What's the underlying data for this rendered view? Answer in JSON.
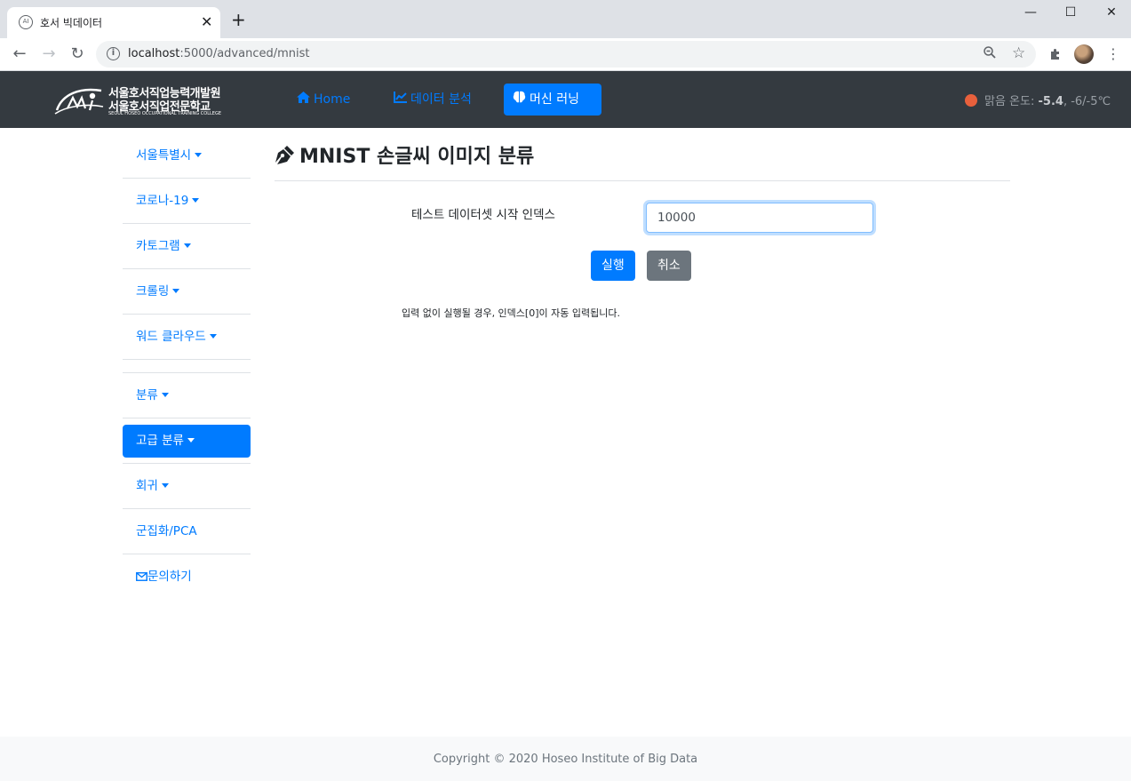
{
  "browser": {
    "tab_title": "호서 빅데이터",
    "tab_favicon": "AI",
    "url_host": "localhost",
    "url_path": ":5000/advanced/mnist"
  },
  "navbar": {
    "logo_line1": "서울호서직업능력개발원",
    "logo_line2": "서울호서직업전문학교",
    "logo_line3": "SEOUL HOSEO OCCUPATIONAL TRAINING COLLEGE",
    "links": [
      {
        "label": "Home",
        "icon": "home-icon"
      },
      {
        "label": "데이터 분석",
        "icon": "chart-line-icon"
      },
      {
        "label": "머신 러닝",
        "icon": "brain-icon",
        "active": true
      }
    ],
    "weather_label": "맑음 온도: ",
    "weather_temp": "-5.4",
    "weather_range": ", -6/-5℃",
    "weather_color": "#e8603c"
  },
  "sidebar": {
    "items": [
      {
        "label": "서울특별시",
        "dropdown": true
      },
      {
        "label": "코로나-19",
        "dropdown": true
      },
      {
        "label": "카토그램",
        "dropdown": true
      },
      {
        "label": "크롤링",
        "dropdown": true
      },
      {
        "label": "워드 클라우드",
        "dropdown": true
      },
      {
        "label": "분류",
        "dropdown": true
      },
      {
        "label": "고급 분류",
        "dropdown": true,
        "active": true
      },
      {
        "label": "회귀",
        "dropdown": true
      },
      {
        "label": "군집화/PCA",
        "dropdown": false
      },
      {
        "label": "문의하기",
        "dropdown": false,
        "icon": "envelope-icon"
      }
    ]
  },
  "main": {
    "title": "MNIST 손글씨 이미지 분류",
    "title_icon": "pen-nib-icon",
    "form": {
      "label": "테스트 데이터셋 시작 인덱스",
      "value": "10000",
      "submit_label": "실행",
      "cancel_label": "취소"
    },
    "help": "입력 없이 실행될 경우, 인덱스[0]이 자동 입력됩니다."
  },
  "footer": {
    "copyright": "Copyright © 2020 Hoseo Institute of Big Data"
  },
  "colors": {
    "primary": "#007bff",
    "secondary": "#6c757d",
    "navbar_bg": "#343a40"
  }
}
